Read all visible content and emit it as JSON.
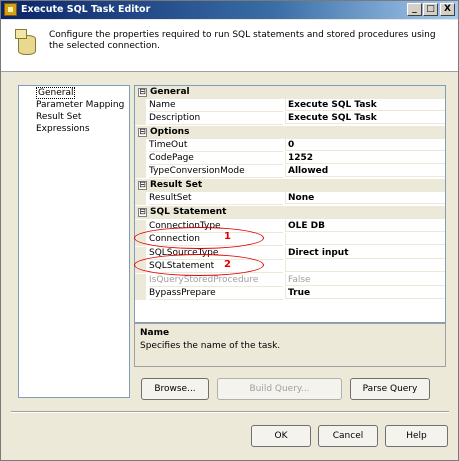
{
  "window": {
    "title": "Execute SQL Task Editor",
    "controls": {
      "minimize": "_",
      "maximize": "□",
      "close": "X"
    }
  },
  "header": {
    "description": "Configure the properties required to run SQL statements and stored procedures using the selected connection."
  },
  "nav": {
    "items": [
      {
        "label": "General",
        "selected": true
      },
      {
        "label": "Parameter Mapping",
        "selected": false
      },
      {
        "label": "Result Set",
        "selected": false
      },
      {
        "label": "Expressions",
        "selected": false
      }
    ]
  },
  "grid": {
    "categories": [
      {
        "label": "General",
        "expander": "⊟",
        "rows": [
          {
            "name": "Name",
            "value": "Execute SQL Task"
          },
          {
            "name": "Description",
            "value": "Execute SQL Task"
          }
        ]
      },
      {
        "label": "Options",
        "expander": "⊟",
        "rows": [
          {
            "name": "TimeOut",
            "value": "0"
          },
          {
            "name": "CodePage",
            "value": "1252"
          },
          {
            "name": "TypeConversionMode",
            "value": "Allowed"
          }
        ]
      },
      {
        "label": "Result Set",
        "expander": "⊟",
        "rows": [
          {
            "name": "ResultSet",
            "value": "None"
          }
        ]
      },
      {
        "label": "SQL Statement",
        "expander": "⊟",
        "rows": [
          {
            "name": "ConnectionType",
            "value": "OLE DB"
          },
          {
            "name": "Connection",
            "value": ""
          },
          {
            "name": "SQLSourceType",
            "value": "Direct input"
          },
          {
            "name": "SQLStatement",
            "value": ""
          },
          {
            "name": "IsQueryStoredProcedure",
            "value": "False"
          },
          {
            "name": "BypassPrepare",
            "value": "True"
          }
        ]
      }
    ]
  },
  "description_panel": {
    "title": "Name",
    "text": "Specifies the name of the task."
  },
  "buttons": {
    "browse": "Browse...",
    "build_query": "Build Query...",
    "parse_query": "Parse Query",
    "ok": "OK",
    "cancel": "Cancel",
    "help": "Help"
  },
  "annotations": {
    "one": "1",
    "two": "2",
    "color": "#e00000"
  }
}
